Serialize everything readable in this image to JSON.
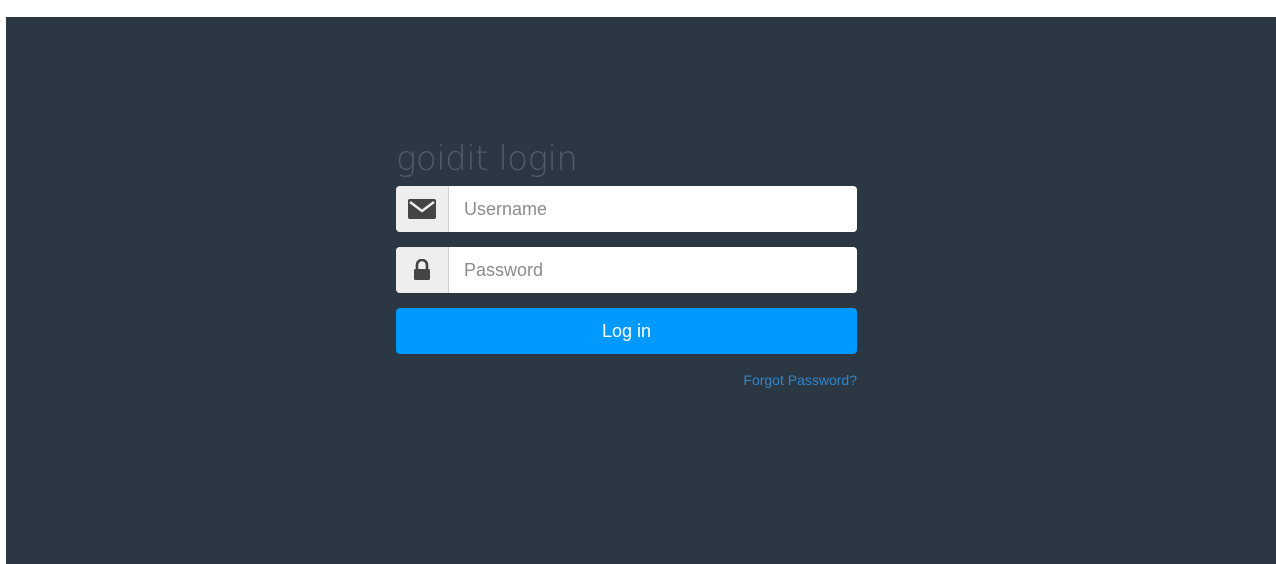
{
  "login": {
    "title": "goidit login",
    "username_placeholder": "Username",
    "password_placeholder": "Password",
    "submit_label": "Log in",
    "forgot_label": "Forgot Password?"
  },
  "colors": {
    "background": "#2b3743",
    "accent": "#0099ff",
    "link": "#2f86cc"
  },
  "icons": {
    "username": "envelope-icon",
    "password": "lock-icon"
  }
}
